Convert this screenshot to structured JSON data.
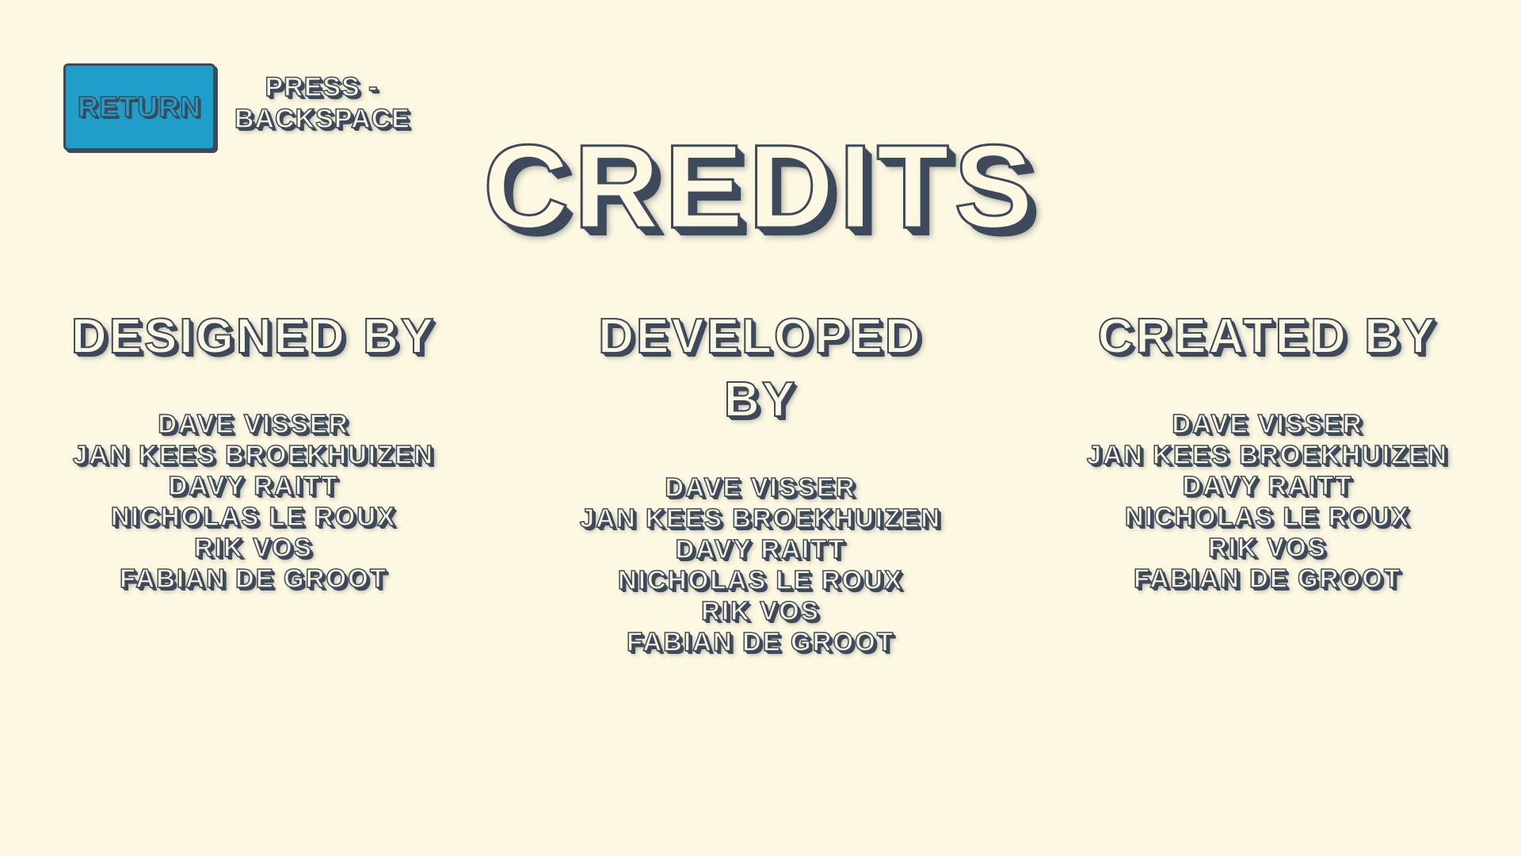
{
  "screen": {
    "title": "Credits"
  },
  "return_button": {
    "label": "Return"
  },
  "key_hint": {
    "line1": "Press -",
    "line2": "Backspace"
  },
  "columns": [
    {
      "heading": "Designed By",
      "names": [
        "Dave Visser",
        "Jan Kees Broekhuizen",
        "Davy Raitt",
        "Nicholas le Roux",
        "Rik Vos",
        "Fabian de Groot"
      ]
    },
    {
      "heading": "Developed By",
      "names": [
        "Dave Visser",
        "Jan Kees Broekhuizen",
        "Davy Raitt",
        "Nicholas le Roux",
        "Rik Vos",
        "Fabian de Groot"
      ]
    },
    {
      "heading": "Created By",
      "names": [
        "Dave Visser",
        "Jan Kees Broekhuizen",
        "Davy Raitt",
        "Nicholas le Roux",
        "Rik Vos",
        "Fabian de Groot"
      ]
    }
  ],
  "colors": {
    "background": "#fdf8e1",
    "text_fill": "#fdf8e1",
    "text_outline": "#3d4a5c",
    "button": "#1f9ec9"
  }
}
